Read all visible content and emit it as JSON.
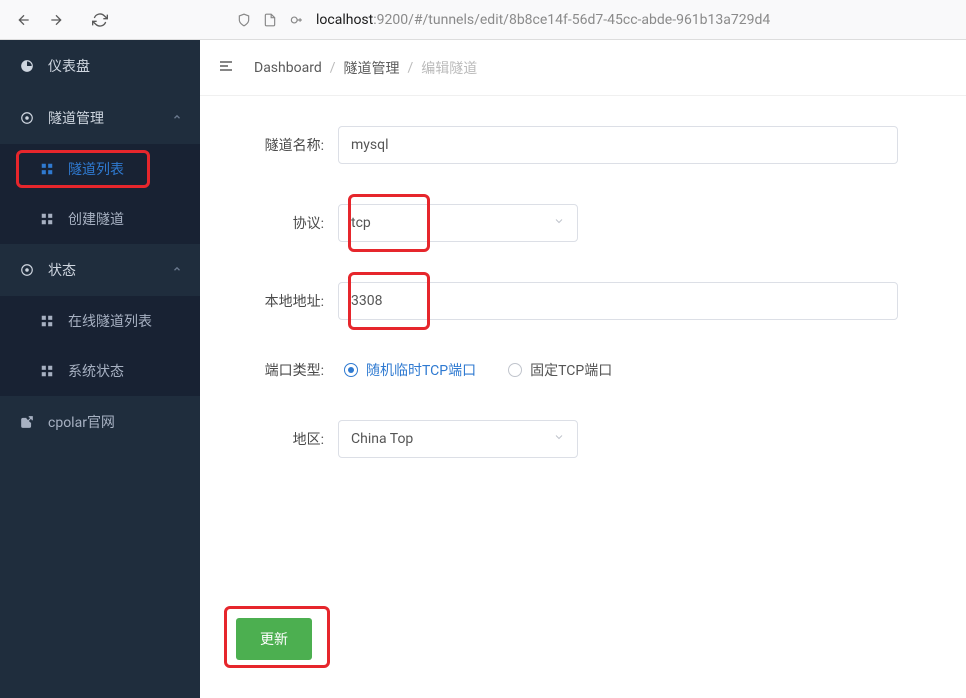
{
  "url": {
    "host": "localhost",
    "path": ":9200/#/tunnels/edit/8b8ce14f-56d7-45cc-abde-961b13a729d4"
  },
  "sidebar": {
    "dashboard": "仪表盘",
    "tunnel_mgmt": "隧道管理",
    "tunnel_list": "隧道列表",
    "create_tunnel": "创建隧道",
    "status": "状态",
    "online_list": "在线隧道列表",
    "system_status": "系统状态",
    "cpolar_site": "cpolar官网"
  },
  "breadcrumb": {
    "dashboard": "Dashboard",
    "tunnel_mgmt": "隧道管理",
    "edit_tunnel": "编辑隧道"
  },
  "form": {
    "name_label": "隧道名称:",
    "name_value": "mysql",
    "protocol_label": "协议:",
    "protocol_value": "tcp",
    "local_addr_label": "本地地址:",
    "local_addr_value": "3308",
    "port_type_label": "端口类型:",
    "port_type_random": "随机临时TCP端口",
    "port_type_fixed": "固定TCP端口",
    "region_label": "地区:",
    "region_value": "China Top",
    "submit_label": "更新"
  }
}
